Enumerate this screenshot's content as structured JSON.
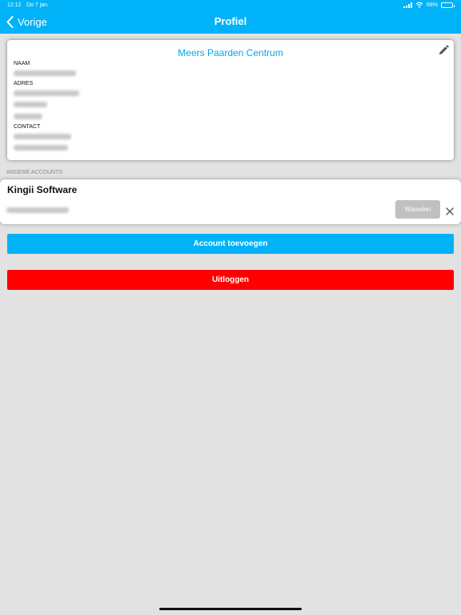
{
  "status_bar": {
    "time": "12:12",
    "date": "Do 7 jan.",
    "battery": "68%",
    "battery_level": 0.68
  },
  "nav": {
    "back_label": "Vorige",
    "title": "Profiel"
  },
  "profile": {
    "org_name": "Meers Paarden Centrum",
    "name_label": "NAAM",
    "address_label": "ADRES",
    "contact_label": "CONTACT",
    "edit_icon": "pencil-icon"
  },
  "accounts": {
    "section_header": "ANDERE ACCOUNTS",
    "items": [
      {
        "name": "Kingii Software",
        "switch_label": "Wisselen"
      }
    ]
  },
  "actions": {
    "add_account_label": "Account toevoegen",
    "logout_label": "Uitloggen"
  },
  "colors": {
    "accent": "#00b2f8",
    "danger": "#ff0000",
    "background": "#e2e2e2"
  }
}
